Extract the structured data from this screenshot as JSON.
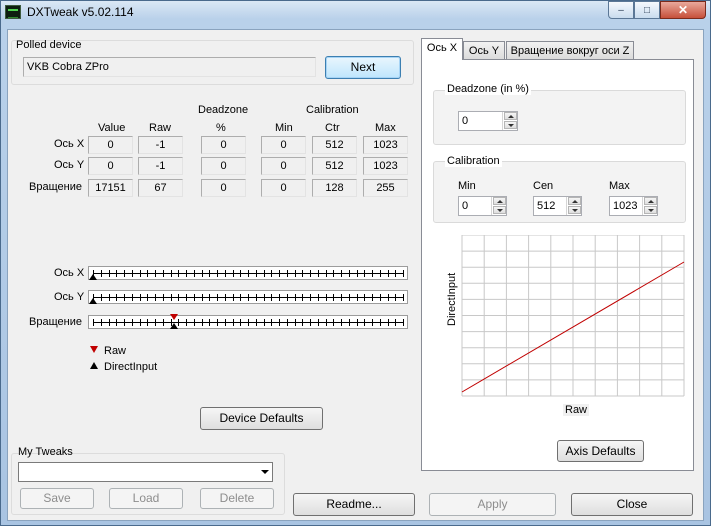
{
  "window": {
    "title": "DXTweak v5.02.114",
    "minimize": "–",
    "maximize": "□",
    "close": "✕"
  },
  "polled": {
    "label": "Polled device",
    "device": "VKB Cobra ZPro",
    "next_label": "Next"
  },
  "table": {
    "headers": {
      "deadzone": "Deadzone",
      "calibration": "Calibration",
      "value": "Value",
      "raw": "Raw",
      "percent": "%",
      "min": "Min",
      "ctr": "Ctr",
      "max": "Max"
    },
    "rows": [
      {
        "label": "Ось X",
        "value": "0",
        "raw": "-1",
        "deadzone": "0",
        "min": "0",
        "ctr": "512",
        "max": "1023"
      },
      {
        "label": "Ось Y",
        "value": "0",
        "raw": "-1",
        "deadzone": "0",
        "min": "0",
        "ctr": "512",
        "max": "1023"
      },
      {
        "label": "Вращение",
        "value": "17151",
        "raw": "67",
        "deadzone": "0",
        "min": "0",
        "ctr": "128",
        "max": "255"
      }
    ]
  },
  "sliders": [
    {
      "label": "Ось X",
      "raw_fraction": null,
      "di_fraction": 0.0
    },
    {
      "label": "Ось Y",
      "raw_fraction": null,
      "di_fraction": 0.0
    },
    {
      "label": "Вращение",
      "raw_fraction": 0.262,
      "di_fraction": 0.262
    }
  ],
  "legend": {
    "raw": "Raw",
    "directinput": "DirectInput"
  },
  "device_defaults_label": "Device Defaults",
  "tweaks": {
    "label": "My Tweaks",
    "selected": "",
    "save": "Save",
    "load": "Load",
    "delete": "Delete"
  },
  "bottom": {
    "readme": "Readme...",
    "apply": "Apply",
    "close": "Close"
  },
  "tabs": [
    "Ось X",
    "Ось Y",
    "Вращение вокруг оси Z"
  ],
  "axis_panel": {
    "deadzone_group": "Deadzone (in %)",
    "deadzone_value": "0",
    "calibration_group": "Calibration",
    "min_label": "Min",
    "cen_label": "Cen",
    "max_label": "Max",
    "min_value": "0",
    "cen_value": "512",
    "max_value": "1023",
    "graph_xlabel": "Raw",
    "graph_ylabel": "DirectInput",
    "axis_defaults_label": "Axis Defaults"
  },
  "colors": {
    "curve": "#c00000",
    "raw_marker": "#c00000",
    "di_marker": "#000000"
  }
}
